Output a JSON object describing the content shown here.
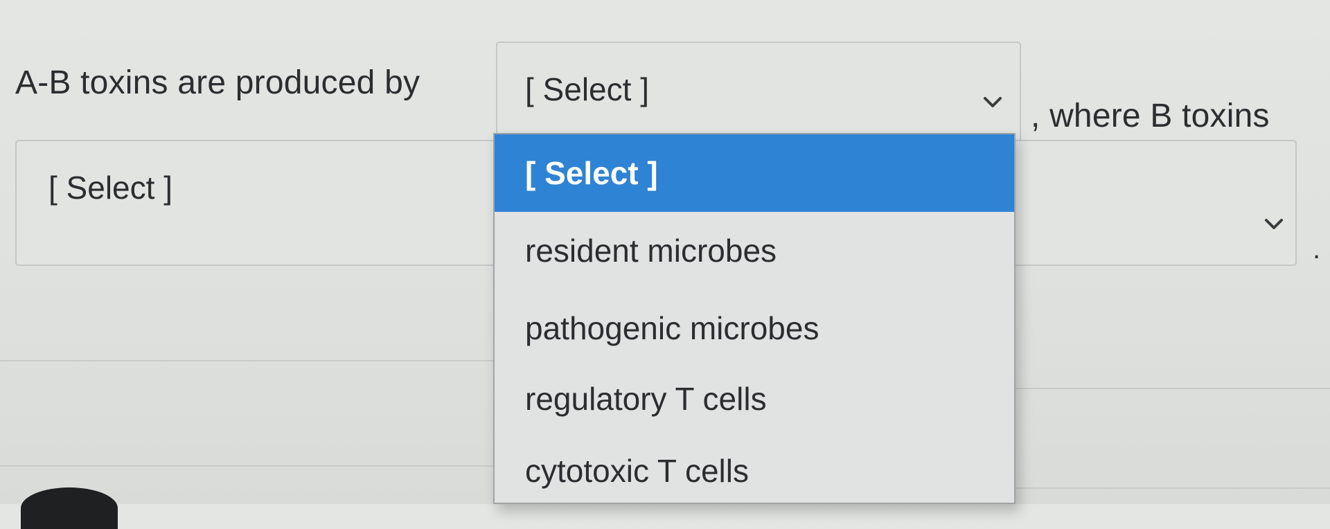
{
  "question": {
    "text_before": "A-B toxins are produced by",
    "text_middle": ", where B toxins",
    "text_after": "."
  },
  "select_1": {
    "value": "[ Select ]",
    "open": true,
    "options": [
      {
        "label": "[ Select ]",
        "selected": true
      },
      {
        "label": "resident microbes",
        "selected": false
      },
      {
        "label": "pathogenic microbes",
        "selected": false
      },
      {
        "label": "regulatory T cells",
        "selected": false
      },
      {
        "label": "cytotoxic T cells",
        "selected": false
      }
    ]
  },
  "select_2": {
    "value": "[ Select ]",
    "open": false
  },
  "icons": {
    "dropdown_arrow": "chevron-down-icon"
  },
  "colors": {
    "highlight": "#2f83d4",
    "highlight_text": "#ffffff",
    "page_background": "#e2e4e2",
    "text": "#2b2d30"
  }
}
